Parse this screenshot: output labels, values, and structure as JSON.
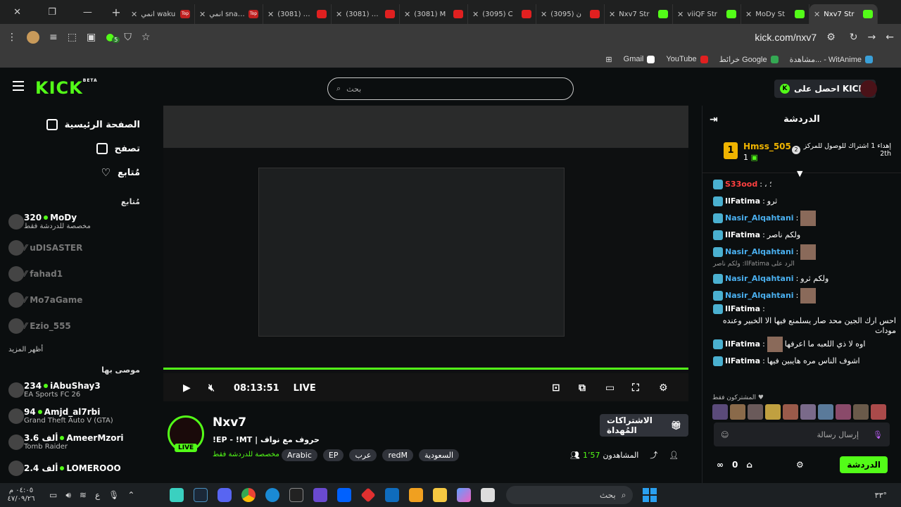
{
  "browser": {
    "tabs": [
      {
        "title": "انمي waku",
        "fav": "top",
        "fav_text": "Top"
      },
      {
        "title": "انمي snake",
        "fav": "top",
        "fav_text": "Top"
      },
      {
        "title": "(3081) انمي",
        "fav": "yt"
      },
      {
        "title": "(3081) YouTube",
        "fav": "yt"
      },
      {
        "title": "(3081) M",
        "fav": "yt"
      },
      {
        "title": "(3095) C",
        "fav": "yt"
      },
      {
        "title": "(3095) ن",
        "fav": "yt"
      },
      {
        "title": "Nxv7 Str",
        "fav": "k"
      },
      {
        "title": "viiQF Str",
        "fav": "k"
      },
      {
        "title": "MoDy St",
        "fav": "k"
      },
      {
        "title": "Nxv7 Str",
        "fav": "k",
        "active": true
      }
    ],
    "url": "kick.com/nxv7",
    "extension_badge": "5",
    "bookmarks": [
      {
        "label": "Gmail",
        "icon": "google-icon",
        "color": "#ffffff"
      },
      {
        "label": "YouTube",
        "icon": "youtube-icon",
        "color": "#e02020"
      },
      {
        "label": "خرائط Google",
        "icon": "maps-icon",
        "color": "#34a853"
      },
      {
        "label": "مشاهدة... - WitAnime",
        "icon": "witanime-icon",
        "color": "#3aa0d8"
      }
    ]
  },
  "header": {
    "logo": "KICK",
    "logo_beta": "BETA",
    "search_placeholder": "بحث",
    "get_kicks": "احصل على KICKs"
  },
  "sidebar": {
    "nav": [
      {
        "label": "الصفحة الرئيسية",
        "icon": "home-icon"
      },
      {
        "label": "تصفح",
        "icon": "browse-icon"
      },
      {
        "label": "مُتابع",
        "icon": "heart-icon"
      }
    ],
    "following_title": "مُتابع",
    "following": [
      {
        "name": "MoDy",
        "viewers": "320",
        "sub": "مخصصة للدردشة فقط",
        "online": true
      },
      {
        "name": "uDISASTER",
        "online": false
      },
      {
        "name": "fahad1",
        "online": false
      },
      {
        "name": "Mo7aGame",
        "online": false
      },
      {
        "name": "Ezio_555",
        "online": false
      }
    ],
    "show_more": "أظهر المزيد",
    "recommended_title": "موصى بها",
    "recommended": [
      {
        "name": "iAbuShay3",
        "viewers": "234",
        "sub": "EA Sports FC 26"
      },
      {
        "name": "Amjd_al7rbi",
        "viewers": "94",
        "sub": "Grand Theft Auto V (GTA)"
      },
      {
        "name": "AmeerMzori",
        "viewers": "3.6 ألف",
        "sub": "Tomb Raider"
      },
      {
        "name": "LOMEROOO",
        "viewers": "2.4 ألف",
        "sub": ""
      }
    ]
  },
  "player": {
    "time": "08:13:51",
    "live": "LIVE"
  },
  "streamer": {
    "name": "Nxv7",
    "live_badge": "LIVE",
    "title": "!EP - !MT | حروف مع نواف",
    "category": "مخصصة للدردشة فقط",
    "tags": [
      "Arabic",
      "EP",
      "عرب",
      "redM",
      "السعودية"
    ],
    "gift_button": "الاشتراكات المُهداة",
    "viewers_label": "المشاهدون",
    "viewers": "1٬57"
  },
  "chat": {
    "title": "الدردشة",
    "pinned": {
      "rank": "1",
      "name": "Hmss_505",
      "count": "1",
      "rank2": "2",
      "desc": "إهداء 1 اشتراك للوصول للمركز 2th"
    },
    "messages": [
      {
        "user": "S33ood",
        "text": "؛ ،",
        "color": "#ff4040",
        "avatar": false
      },
      {
        "user": "IlFatima",
        "text": "ثرو",
        "color": "#ffffff",
        "avatar": false
      },
      {
        "user": "Nasir_Alqahtani",
        "text": "",
        "color": "#4ab0f0",
        "avatar": true
      },
      {
        "user": "IlFatima",
        "text": "ولكم ناصر",
        "color": "#ffffff",
        "avatar": false
      },
      {
        "user": "Nasir_Alqahtani",
        "text": "",
        "color": "#4ab0f0",
        "avatar": true
      },
      {
        "user": "Nasir_Alqahtani",
        "text": "ولكم ثرو",
        "color": "#4ab0f0",
        "avatar": false,
        "reply": "الرد على IlFatima: ولكم ناصر"
      },
      {
        "user": "Nasir_Alqahtani",
        "text": "",
        "color": "#4ab0f0",
        "avatar": true
      },
      {
        "user": "IlFatima",
        "text": "احس ارك الجين محد صار يسلمنع فيها الا الخبير وعنده مودات",
        "color": "#ffffff",
        "avatar": false
      },
      {
        "user": "IlFatima",
        "text": "اوه لا ذي اللعبه ما اعرفها",
        "color": "#ffffff",
        "avatar": true
      },
      {
        "user": "IlFatima",
        "text": "اشوف الناس مره هايبين فيها",
        "color": "#ffffff",
        "avatar": false
      }
    ],
    "subs_label": "المشتركون فقط",
    "input_placeholder": "إرسال رسالة",
    "kicks_count": "0",
    "send_button": "الدردشة"
  },
  "taskbar": {
    "time": "٠٤:٠٥ م",
    "date": "٤٧/٠٩/٢٦",
    "lang": "ع",
    "search": "بحث",
    "weather": "٣٣°"
  }
}
